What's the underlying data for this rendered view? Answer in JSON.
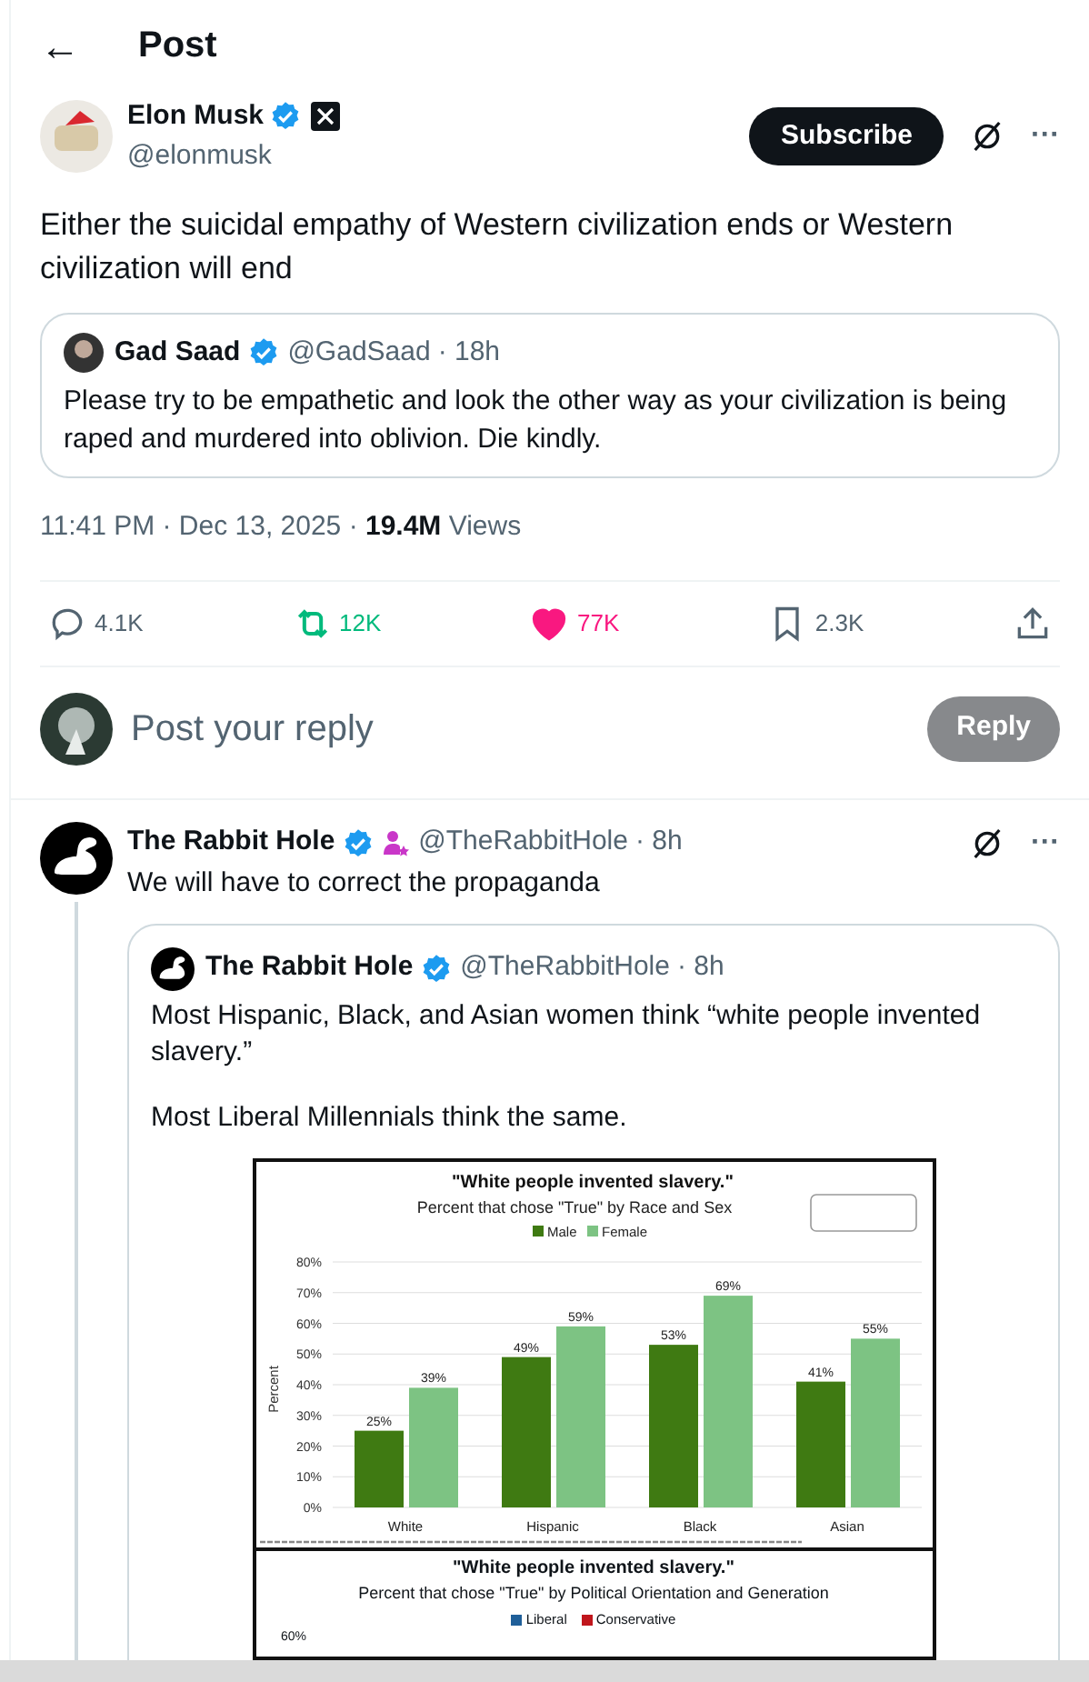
{
  "header": {
    "back": "←",
    "title": "Post"
  },
  "post": {
    "author": "Elon Musk",
    "verified": true,
    "handle": "@elonmusk",
    "subscribe": "Subscribe",
    "more": "···",
    "text": "Either the suicidal empathy of Western civilization ends or Western civilization will end",
    "quote": {
      "author": "Gad Saad",
      "verified": true,
      "handle": "@GadSaad",
      "time": "· 18h",
      "text": "Please try to be empathetic and look the other way as your civilization is being raped and murdered into oblivion. Die kindly."
    },
    "meta": "11:41 PM · Dec 13, 2025 · ",
    "views": "19.4M",
    "views_label": "Views",
    "actions": [
      {
        "kind": "reply",
        "count": "4.1K",
        "active": false
      },
      {
        "kind": "repost",
        "count": "12K",
        "active": true
      },
      {
        "kind": "like",
        "count": "77K",
        "active": true
      },
      {
        "kind": "bookmark",
        "count": "2.3K",
        "active": false
      },
      {
        "kind": "share"
      }
    ]
  },
  "composer": {
    "placeholder": "Post your reply",
    "button": "Reply",
    "disabled": true
  },
  "reply": {
    "author": "The Rabbit Hole",
    "verified": true,
    "handle": "@TheRabbitHole",
    "time": "· 8h",
    "more": "···",
    "text": "We will have to correct the propaganda",
    "quote": {
      "author": "The Rabbit Hole",
      "verified": true,
      "handle": "@TheRabbitHole",
      "time": "· 8h",
      "paragraphs": [
        "Most Hispanic, Black, and Asian women think “white people invented slavery.”",
        "Most Liberal Millennials think the same."
      ],
      "chart_data": {
        "type": "bar",
        "title": "\"White people invented slavery.\"",
        "subtitle": "Percent that chose \"True\" by Race and Sex",
        "ylabel": "Percent",
        "categories": [
          "White",
          "Hispanic",
          "Black",
          "Asian"
        ],
        "series": [
          {
            "name": "Male",
            "color": "#3f7a12",
            "values": [
              25,
              49,
              53,
              41
            ]
          },
          {
            "name": "Female",
            "color": "#7dc383",
            "values": [
              39,
              59,
              69,
              55
            ]
          }
        ],
        "ylim": [
          0,
          80
        ],
        "grid": true,
        "legend": true,
        "yticks": [
          {
            "value": 0,
            "label": "0%"
          },
          {
            "value": 10,
            "label": "10%"
          },
          {
            "value": 20,
            "label": "20%"
          },
          {
            "value": 30,
            "label": "30%"
          },
          {
            "value": 40,
            "label": "40%"
          },
          {
            "value": 50,
            "label": "50%"
          },
          {
            "value": 60,
            "label": "60%"
          },
          {
            "value": 70,
            "label": "70%"
          },
          {
            "value": 80,
            "label": "80%"
          }
        ],
        "value_labels": [
          [
            "25%",
            "49%",
            "53%",
            "41%"
          ],
          [
            "39%",
            "59%",
            "69%",
            "55%"
          ]
        ]
      },
      "chart2": {
        "title": "\"White people invented slavery.\"",
        "subtitle": "Percent that chose \"True\" by Political Orientation and Generation",
        "legend": [
          {
            "name": "Liberal",
            "color": "#1f5f99"
          },
          {
            "name": "Conservative",
            "color": "#c0161c"
          }
        ],
        "tick": "60%"
      }
    }
  }
}
